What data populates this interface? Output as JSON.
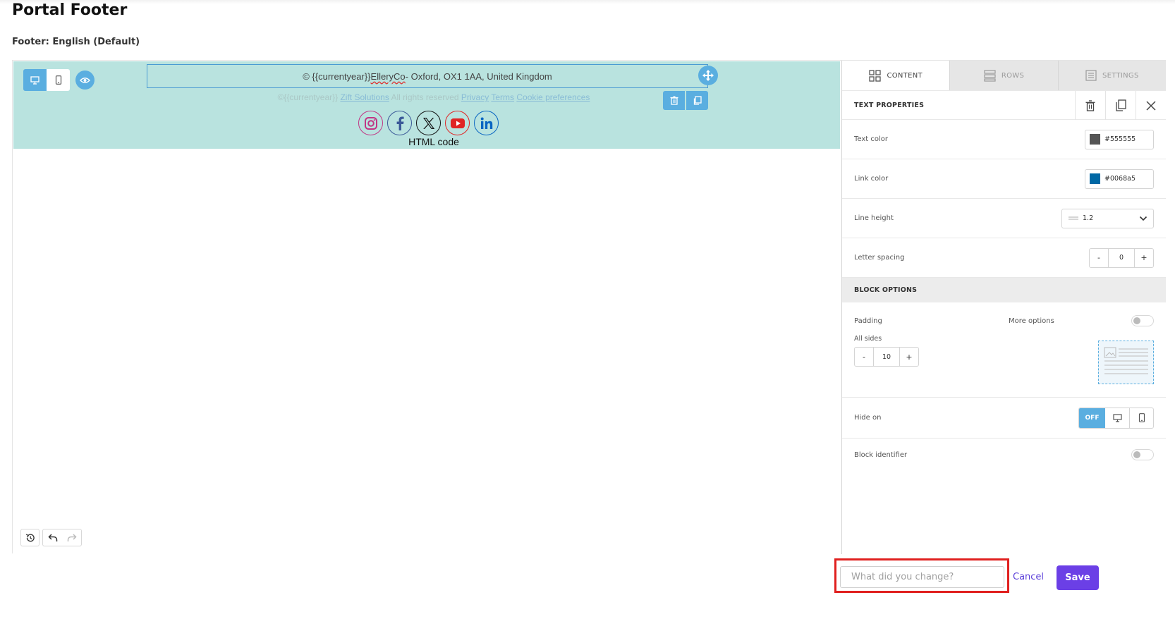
{
  "page": {
    "title": "Portal Footer",
    "subtitle": "Footer: English (Default)"
  },
  "canvas": {
    "footer_text_prefix": "© {{currentyear}} ",
    "footer_text_company": "ElleryCo",
    "footer_text_suffix": " - Oxford, OX1 1AA, United Kingdom",
    "faded_prefix": "©{{currentyear}} ",
    "faded_link_company": "Zift Solutions",
    "faded_rights": " All rights reserved ",
    "faded_link_privacy": "Privacy",
    "faded_link_terms": "Terms",
    "faded_link_cookies": "Cookie preferences",
    "html_code_label": "HTML code",
    "social_icons": [
      "instagram-icon",
      "facebook-icon",
      "x-icon",
      "youtube-icon",
      "linkedin-icon"
    ]
  },
  "sidebar": {
    "tabs": [
      {
        "label": "CONTENT",
        "active": true
      },
      {
        "label": "ROWS",
        "active": false
      },
      {
        "label": "SETTINGS",
        "active": false
      }
    ],
    "text_properties_title": "TEXT PROPERTIES",
    "text_color_label": "Text color",
    "text_color_value": "#555555",
    "link_color_label": "Link color",
    "link_color_value": "#0068a5",
    "line_height_label": "Line height",
    "line_height_value": "1.2",
    "letter_spacing_label": "Letter spacing",
    "letter_spacing_value": "0",
    "block_options_title": "BLOCK OPTIONS",
    "padding_label": "Padding",
    "more_options_label": "More options",
    "all_sides_label": "All sides",
    "padding_value": "10",
    "hide_on_label": "Hide on",
    "hide_on_off": "OFF",
    "block_identifier_label": "Block identifier",
    "minus": "-",
    "plus": "+"
  },
  "footer_bar": {
    "comment_placeholder": "What did you change?",
    "cancel_label": "Cancel",
    "save_label": "Save"
  },
  "colors": {
    "accent": "#5aaee0",
    "row_background": "#b9e3df",
    "save_button": "#6b3fe6",
    "highlight_box": "#e0201f"
  }
}
